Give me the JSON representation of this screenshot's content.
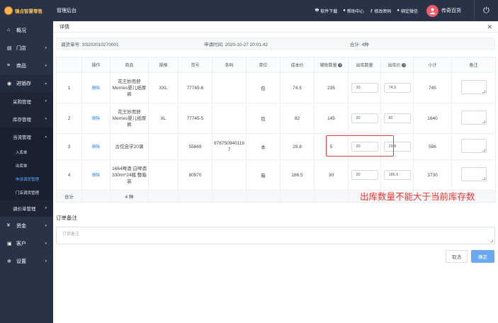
{
  "app": {
    "logo_text": "镇点智慧零售",
    "system_title": "管理后台"
  },
  "topnav": [
    {
      "icon": "printer-icon",
      "glyph": "🖶",
      "label": "软件下载"
    },
    {
      "icon": "help-icon",
      "glyph": "●",
      "label": "帮助中心"
    },
    {
      "icon": "key-icon",
      "glyph": "⚷",
      "label": "修改密码"
    },
    {
      "icon": "wechat-icon",
      "glyph": "●",
      "label": "绑定微信"
    }
  ],
  "user": {
    "name": "传奇百货"
  },
  "sidebar": {
    "overview": "概况",
    "store": "门店",
    "goods": "商品",
    "inventory": "进销存",
    "purchase": "采购管理",
    "stock": "库存管理",
    "transfer": "当流管理",
    "transfer_items": [
      "入库单",
      "出库单",
      "申请调货管理",
      "门店调货管理"
    ],
    "adjust": "调价单管理",
    "finance": "资金",
    "customer": "客户",
    "settings": "设置"
  },
  "panel": {
    "title": "详情",
    "order_no": "调货单号: SS202010270001",
    "apply_time": "申请时间: 2020-10-27 20:01:42",
    "total": "合计: 4种"
  },
  "table": {
    "headers": [
      "操作",
      "商品",
      "规格",
      "货号",
      "条码",
      "单位",
      "成本价",
      "辅助数量",
      "出库数量",
      "出库价",
      "小计",
      "备注"
    ],
    "delete_label": "删除",
    "rows": [
      {
        "idx": "1",
        "product": "花王妙而舒Merries婴儿纸尿裤",
        "spec": "XXL",
        "sku": "77745-6",
        "barcode": "",
        "unit": "包",
        "cost": "74.5",
        "aux": "235",
        "qty": "10",
        "price": "74.5",
        "subtotal": "745"
      },
      {
        "idx": "2",
        "product": "花王妙而舒Merries婴儿纸尿裤",
        "spec": "XL",
        "sku": "77745-5",
        "barcode": "",
        "unit": "包",
        "cost": "82",
        "aux": "145",
        "qty": "20",
        "price": "82",
        "subtotal": "1640"
      },
      {
        "idx": "3",
        "product": "古佗自学20课",
        "spec": "",
        "sku": "55669",
        "barcode": "9787509401187",
        "unit": "本",
        "cost": "29.8",
        "aux": "5",
        "qty": "20",
        "price": "29.8",
        "subtotal": "596"
      },
      {
        "idx": "4",
        "product": "1664啤酒 白啤酒330ml*24瓶 整箱装",
        "spec": "",
        "sku": "80970",
        "barcode": "",
        "unit": "箱",
        "cost": "186.5",
        "aux": "30",
        "qty": "20",
        "price": "186.5",
        "subtotal": "3730"
      }
    ],
    "total_label": "合计",
    "total_kinds": "4 种"
  },
  "warning": "出库数量不能大于当前库存数",
  "remark": {
    "label": "订单备注",
    "placeholder": "订单备注"
  },
  "buttons": {
    "cancel": "取消",
    "ok": "确定"
  }
}
